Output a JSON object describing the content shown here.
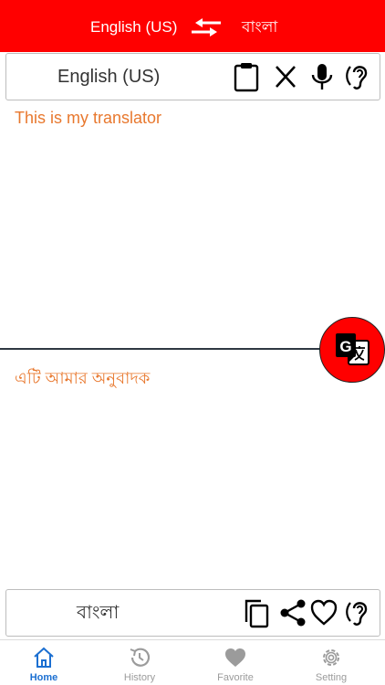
{
  "header": {
    "source_language": "English (US)",
    "target_language": "বাংলা",
    "swap_icon": "swap-arrows-icon",
    "background_color": "#ff0000"
  },
  "input_bar": {
    "language_label": "English (US)",
    "icons": [
      "clipboard-icon",
      "clear-icon",
      "microphone-icon",
      "listen-icon"
    ]
  },
  "input": {
    "text": "This is my translator"
  },
  "translate_button": {
    "icon": "google-translate-icon",
    "color": "#ff0000"
  },
  "output": {
    "text": "এটি আমার অনুবাদক"
  },
  "output_bar": {
    "language_label": "বাংলা",
    "icons": [
      "copy-icon",
      "share-icon",
      "favorite-icon",
      "listen-icon"
    ]
  },
  "tabs": [
    {
      "label": "Home",
      "icon": "home-icon",
      "active": true
    },
    {
      "label": "History",
      "icon": "history-icon",
      "active": false
    },
    {
      "label": "Favorite",
      "icon": "heart-icon",
      "active": false
    },
    {
      "label": "Setting",
      "icon": "gear-icon",
      "active": false
    }
  ],
  "colors": {
    "accent": "#ff0000",
    "text_orange": "#e8782e",
    "tab_active": "#1b6fd1",
    "tab_inactive": "#9b9b9b"
  }
}
